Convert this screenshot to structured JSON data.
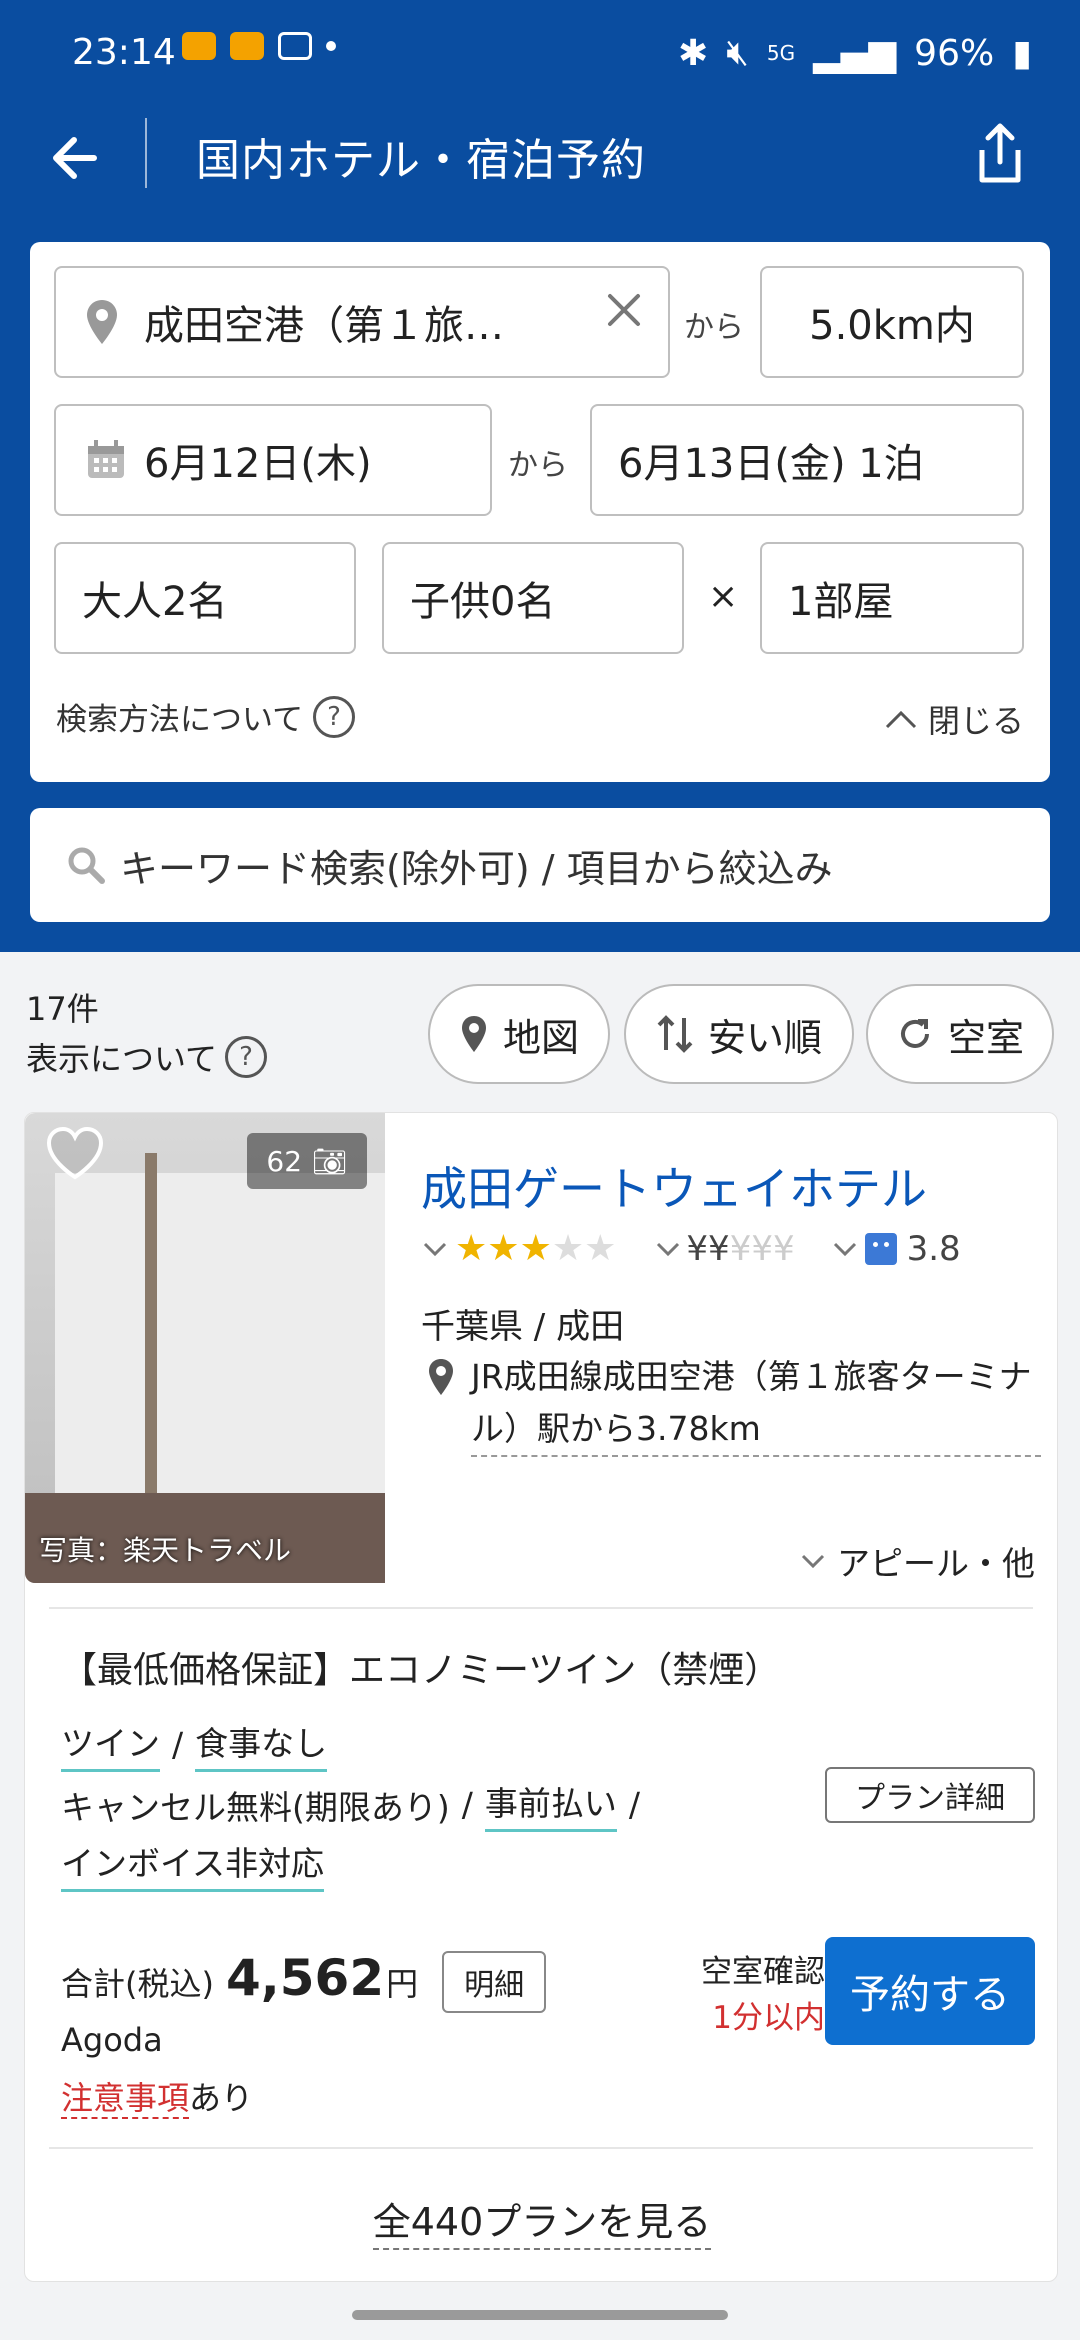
{
  "status": {
    "time": "23:14",
    "battery": "96%",
    "network": "5G"
  },
  "appbar": {
    "title": "国内ホテル・宿泊予約"
  },
  "search": {
    "location": "成田空港（第１旅…",
    "from_label": "から",
    "distance": "5.0km内",
    "checkin": "6月12日(木)",
    "checkout": "6月13日(金) 1泊",
    "adults": "大人2名",
    "children": "子供0名",
    "times": "×",
    "rooms": "1部屋",
    "help": "検索方法について",
    "close": "閉じる",
    "keyword": "キーワード検索(除外可) / 項目から絞込み"
  },
  "results": {
    "count": "17件",
    "display_note": "表示について",
    "map_btn": "地図",
    "sort_btn": "安い順",
    "vacancy_btn": "空室"
  },
  "hotel": {
    "name": "成田ゲートウェイホテル",
    "photo_count": "62",
    "photo_credit": "写真：楽天トラベル",
    "stars_on": 3,
    "stars_total": 5,
    "price_level": 2,
    "review_score": "3.8",
    "prefecture": "千葉県 / 成田",
    "access": "JR成田線成田空港（第１旅客ターミナル）駅から3.78km",
    "appeal": "アピール・他",
    "plan_title": "【最低価格保証】エコノミーツイン（禁煙）",
    "room_type": "ツイン",
    "meal": "食事なし",
    "cancel": "キャンセル無料(期限あり)",
    "payment": "事前払い",
    "invoice": "インボイス非対応",
    "plan_detail_btn": "プラン詳細",
    "total_label": "合計(税込)",
    "price": "4,562",
    "yen": "円",
    "breakdown_btn": "明細",
    "provider": "Agoda",
    "notice_red": "注意事項",
    "notice_rest": "あり",
    "avail_label": "空室確認",
    "avail_time": "1分以内",
    "book_btn": "予約する",
    "all_plans": "全440プランを見る"
  },
  "colors": {
    "primary": "#0a4da0",
    "link": "#0a57b8",
    "button": "#0e6fd0",
    "accent_red": "#d23030",
    "star": "#f0b400"
  }
}
